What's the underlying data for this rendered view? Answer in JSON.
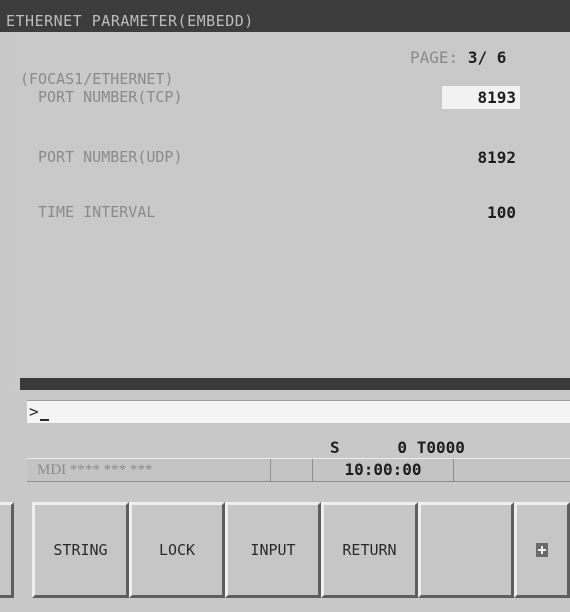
{
  "header": {
    "title": "ETHERNET PARAMETER(EMBEDD)",
    "page_label": "PAGE:",
    "page_current": "3",
    "page_separator": "/",
    "page_total": "6"
  },
  "section": {
    "title": "(FOCAS1/ETHERNET)"
  },
  "params": [
    {
      "label": "PORT NUMBER(TCP)",
      "value": "8193"
    },
    {
      "label": "PORT NUMBER(UDP)",
      "value": "8192"
    },
    {
      "label": "TIME INTERVAL",
      "value": "100"
    }
  ],
  "input": {
    "prompt": ">",
    "value": ""
  },
  "spindle": {
    "text": "S      0 T0000"
  },
  "status": {
    "mode": "MDI **** *** ***",
    "time": "10:00:00"
  },
  "softkeys": [
    {
      "label": "STRING"
    },
    {
      "label": "LOCK"
    },
    {
      "label": "INPUT"
    },
    {
      "label": "RETURN"
    },
    {
      "label": ""
    },
    {
      "icon": "plus-icon"
    }
  ]
}
